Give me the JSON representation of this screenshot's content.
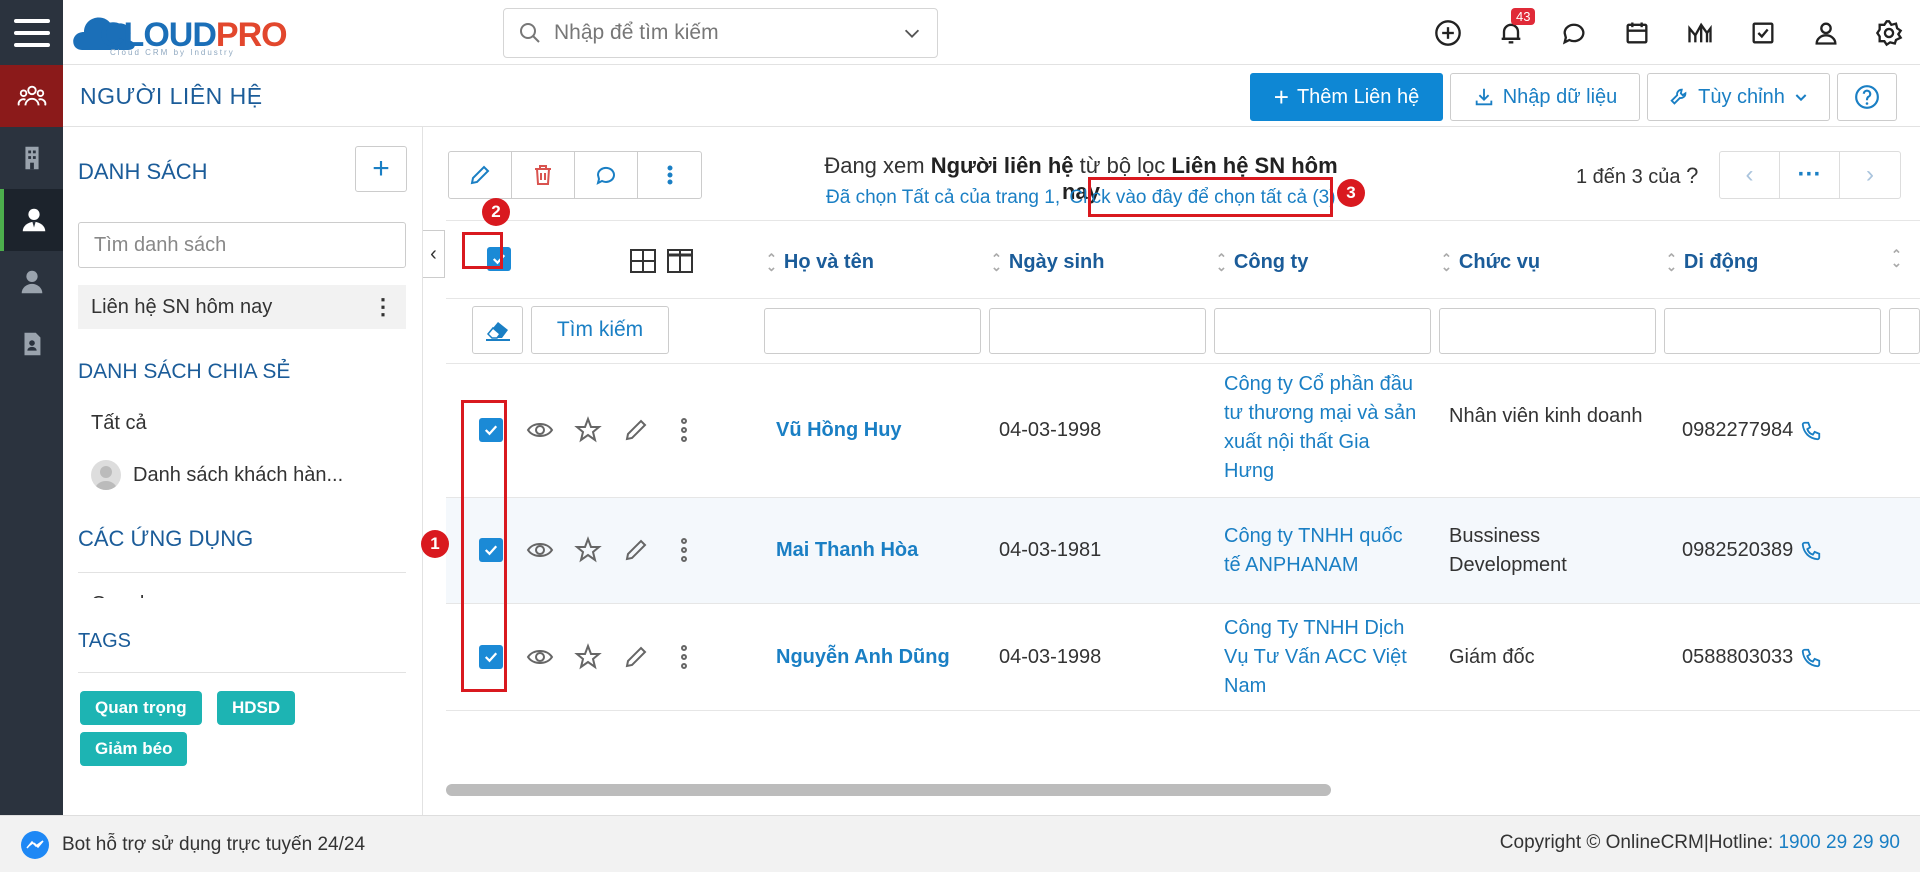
{
  "app": {
    "logo_main": "CLOUD",
    "logo_accent": "PRO",
    "logo_sub": "Cloud CRM by Industry"
  },
  "search": {
    "placeholder": "Nhập để tìm kiếm"
  },
  "notifications": {
    "count": "43"
  },
  "page": {
    "title": "NGƯỜI LIÊN HỆ",
    "add_button": "Thêm Liên hệ",
    "import_button": "Nhập dữ liệu",
    "customize_button": "Tùy chỉnh"
  },
  "sidebar": {
    "list_heading": "DANH SÁCH",
    "list_search_placeholder": "Tìm danh sách",
    "lists": [
      {
        "label": "Liên hệ SN hôm nay"
      }
    ],
    "shared_heading": "DANH SÁCH CHIA SẺ",
    "shared": [
      {
        "label": "Tất cả"
      },
      {
        "label": "Danh sách khách hàn..."
      }
    ],
    "apps_heading": "CÁC ỨNG DỤNG",
    "apps_partial": "Google",
    "tags_heading": "TAGS",
    "tags": [
      {
        "label": "Quan trọng"
      },
      {
        "label": "HDSD"
      },
      {
        "label": "Giảm béo"
      }
    ]
  },
  "viewing": {
    "prefix": "Đang xem ",
    "module": "Người liên hệ",
    "middle": " từ bộ lọc ",
    "filter": "Liên hệ SN hôm nay"
  },
  "selection": {
    "text": "Đã chọn Tất cả của trang 1,",
    "link": "Click vào đây để chọn tất cả (3)"
  },
  "pager": {
    "text": "1 đến 3 của",
    "unknown": "?"
  },
  "table": {
    "columns": [
      "Họ và tên",
      "Ngày sinh",
      "Công ty",
      "Chức vụ",
      "Di động"
    ],
    "search_button": "Tìm kiếm",
    "rows": [
      {
        "name": "Vũ Hồng Huy",
        "dob": "04-03-1998",
        "company": "Công ty Cổ phần đầu tư thương mại và sản xuất nội thất Gia Hưng",
        "title": "Nhân viên kinh doanh",
        "mobile": "0982277984"
      },
      {
        "name": "Mai Thanh Hòa",
        "dob": "04-03-1981",
        "company": "Công ty TNHH quốc tế ANPHANAM",
        "title": "Bussiness Development",
        "mobile": "0982520389"
      },
      {
        "name": "Nguyễn Anh Dũng",
        "dob": "04-03-1998",
        "company": "Công Ty TNHH Dịch Vụ Tư Vấn ACC Việt Nam",
        "title": "Giám đốc",
        "mobile": "0588803033"
      }
    ]
  },
  "annotations": [
    "1",
    "2",
    "3"
  ],
  "footer": {
    "bot": "Bot hỗ trợ sử dụng trực tuyến 24/24",
    "copyright": "Copyright © OnlineCRM|Hotline: ",
    "hotline": "1900 29 29 90"
  },
  "colors": {
    "primary": "#0e87d4",
    "header_text": "#1b5c99",
    "rail": "#2b333e",
    "tag": "#1db4b3",
    "annotation": "#d9191f"
  }
}
